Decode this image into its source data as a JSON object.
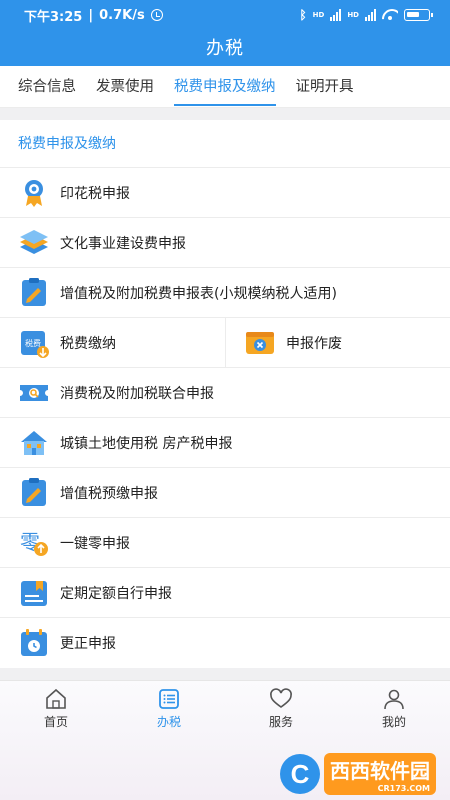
{
  "status_bar": {
    "time": "下午3:25",
    "speed": "0.7K/s",
    "network": "HD"
  },
  "header": {
    "title": "办税"
  },
  "tabs": [
    {
      "label": "综合信息",
      "active": false
    },
    {
      "label": "发票使用",
      "active": false
    },
    {
      "label": "税费申报及缴纳",
      "active": true
    },
    {
      "label": "证明开具",
      "active": false
    }
  ],
  "section": {
    "title": "税费申报及缴纳"
  },
  "items": {
    "stamp_tax": "印花税申报",
    "culture_fee": "文化事业建设费申报",
    "vat_small": "增值税及附加税费申报表(小规模纳税人适用)",
    "tax_payment": "税费缴纳",
    "void_declaration": "申报作废",
    "consumption_tax": "消费税及附加税联合申报",
    "land_property": "城镇土地使用税 房产税申报",
    "vat_prepay": "增值税预缴申报",
    "zero_declaration": "一键零申报",
    "fixed_quota": "定期定额自行申报",
    "correction": "更正申报"
  },
  "icon_badges": {
    "tax_payment": "税费",
    "zero": "零"
  },
  "bottom_nav": [
    {
      "label": "首页",
      "icon": "home-icon",
      "active": false
    },
    {
      "label": "办税",
      "icon": "list-icon",
      "active": true
    },
    {
      "label": "服务",
      "icon": "heart-icon",
      "active": false
    },
    {
      "label": "我的",
      "icon": "user-icon",
      "active": false
    }
  ],
  "watermark": {
    "text": "西西软件园",
    "sub": "CR173.COM"
  },
  "colors": {
    "primary": "#2f93ea",
    "accent_orange": "#f5a623",
    "background": "#f3f3f5"
  }
}
